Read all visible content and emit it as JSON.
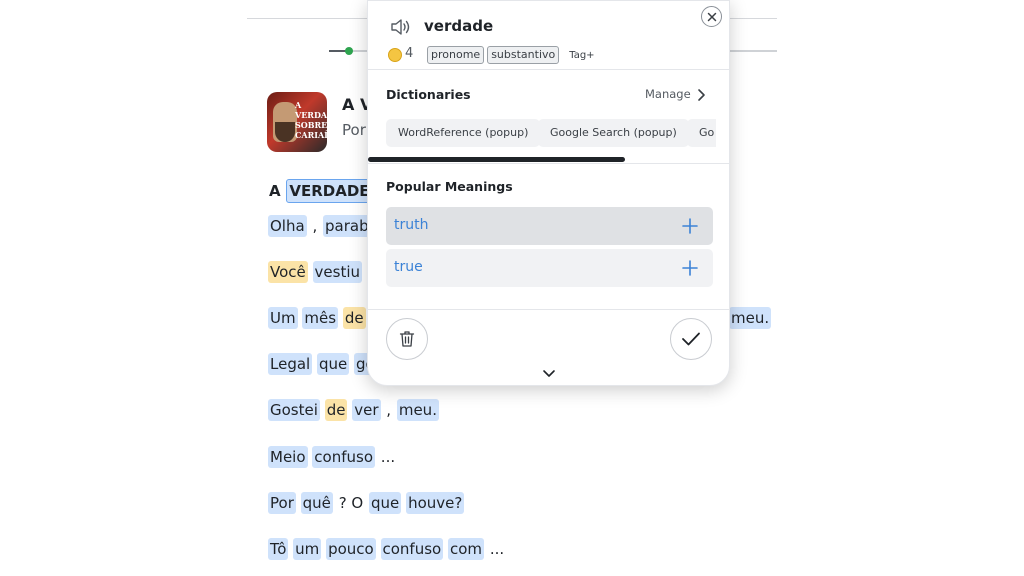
{
  "lesson": {
    "title": "A V",
    "author": "Por",
    "cover_text": "A VERDADE SOBRE CARIAÍ"
  },
  "lines": [
    [
      {
        "t": "A",
        "k": "bold"
      },
      {
        "t": "VERDADE",
        "k": "sel"
      }
    ],
    [
      {
        "t": "Olha",
        "k": "w"
      },
      {
        "t": ",",
        "k": "p"
      },
      {
        "t": "parabé",
        "k": "w"
      }
    ],
    [
      {
        "t": "Você",
        "k": "y"
      },
      {
        "t": "vestiu",
        "k": "w"
      }
    ],
    [
      {
        "t": "Um",
        "k": "w"
      },
      {
        "t": "mês",
        "k": "w"
      },
      {
        "t": "de",
        "k": "y"
      }
    ],
    [
      {
        "t": "Legal",
        "k": "w"
      },
      {
        "t": "que",
        "k": "w"
      },
      {
        "t": "go",
        "k": "w"
      }
    ],
    [
      {
        "t": "Gostei",
        "k": "w"
      },
      {
        "t": "de",
        "k": "y"
      },
      {
        "t": "ver",
        "k": "w"
      },
      {
        "t": ",",
        "k": "p"
      },
      {
        "t": "meu.",
        "k": "w"
      }
    ],
    [
      {
        "t": "Meio",
        "k": "w"
      },
      {
        "t": "confuso",
        "k": "w"
      },
      {
        "t": "...",
        "k": "p"
      }
    ],
    [
      {
        "t": "Por",
        "k": "w"
      },
      {
        "t": "quê",
        "k": "w"
      },
      {
        "t": "? O",
        "k": "p"
      },
      {
        "t": "que",
        "k": "w"
      },
      {
        "t": "houve?",
        "k": "w"
      }
    ],
    [
      {
        "t": "Tô",
        "k": "w"
      },
      {
        "t": "um",
        "k": "w"
      },
      {
        "t": "pouco",
        "k": "w"
      },
      {
        "t": "confuso",
        "k": "w"
      },
      {
        "t": "com",
        "k": "w"
      },
      {
        "t": "...",
        "k": "p"
      }
    ]
  ],
  "line_tail": "meu.",
  "popup": {
    "word": "verdade",
    "coin_count": "4",
    "tags": [
      "pronome",
      "substantivo"
    ],
    "tag_add": "Tag+",
    "dictionaries_label": "Dictionaries",
    "manage_label": "Manage",
    "dictionaries": [
      "WordReference (popup)",
      "Google Search (popup)",
      "Go"
    ],
    "popular_meanings_label": "Popular Meanings",
    "meanings": [
      "truth",
      "true"
    ]
  },
  "colors": {
    "word_highlight": "#cfe2fb",
    "new_word_highlight": "#fbe3a7",
    "meaning_text": "#3b82d6",
    "progress_dot": "#2ea44f"
  },
  "icons": [
    "speaker-icon",
    "close-icon",
    "coin-icon",
    "chevron-right-icon",
    "plus-icon",
    "trash-icon",
    "check-icon",
    "chevron-down-icon"
  ]
}
